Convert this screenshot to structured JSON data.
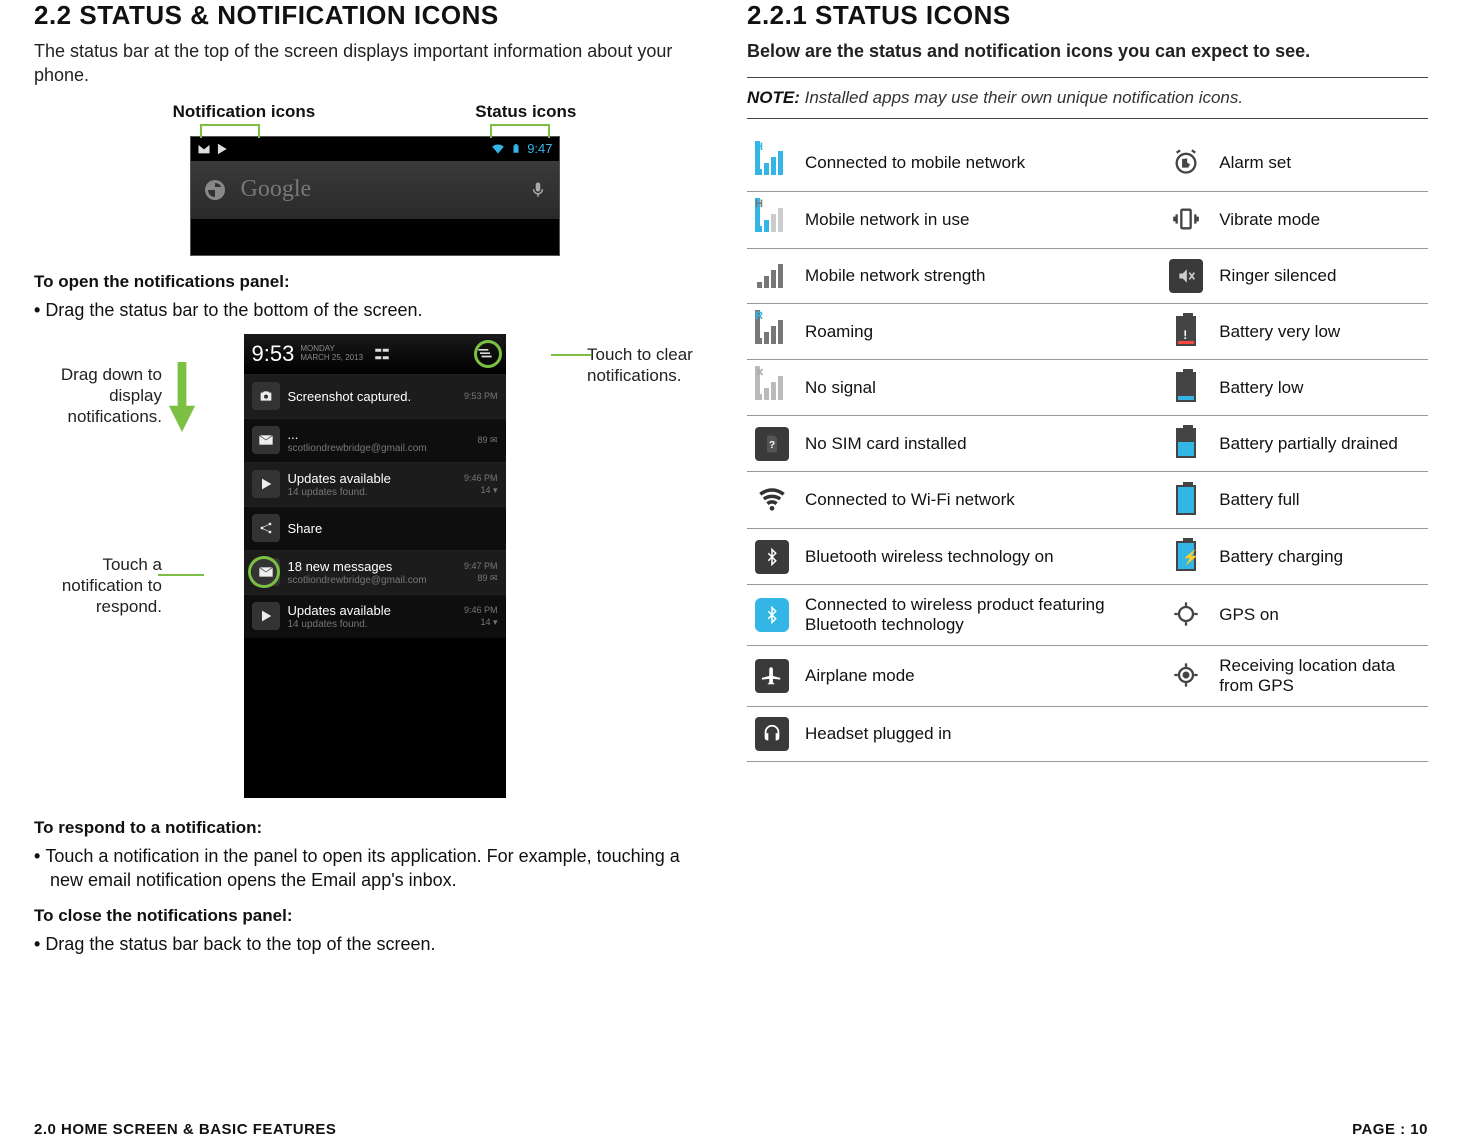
{
  "left": {
    "heading": "2.2 STATUS & NOTIFICATION ICONS",
    "intro": "The status bar at the top of the screen displays important information about your phone.",
    "labels": {
      "notification_icons": "Notification icons",
      "status_icons": "Status icons"
    },
    "statusbar": {
      "time": "9:47",
      "google_placeholder": "Google"
    },
    "open_panel_title": "To open the notifications panel:",
    "open_panel_step": "Drag the status bar to the bottom of the screen.",
    "callouts": {
      "drag_down": "Drag down to display notifications.",
      "touch_respond": "Touch a notification to respond.",
      "touch_clear": "Touch to clear notifications."
    },
    "panel": {
      "time": "9:53",
      "day": "MONDAY",
      "date": "MARCH 25, 2013",
      "rows": [
        {
          "icon": "camera",
          "title": "Screenshot captured.",
          "subtitle": "",
          "meta1": "9:53 PM",
          "meta2": ""
        },
        {
          "icon": "mail",
          "title": "...",
          "subtitle": "scotliondrewbridge@gmail.com",
          "meta1": "",
          "meta2": "89 ✉"
        },
        {
          "icon": "play",
          "title": "Updates available",
          "subtitle": "14 updates found.",
          "meta1": "9:46 PM",
          "meta2": "14 ▾"
        },
        {
          "icon": "share",
          "title": "Share",
          "subtitle": "",
          "meta1": "",
          "meta2": ""
        },
        {
          "icon": "mail",
          "title": "18 new messages",
          "subtitle": "scotliondrewbridge@gmail.com",
          "meta1": "9:47 PM",
          "meta2": "89 ✉"
        },
        {
          "icon": "play",
          "title": "Updates available",
          "subtitle": "14 updates found.",
          "meta1": "9:46 PM",
          "meta2": "14 ▾"
        }
      ]
    },
    "respond_title": "To respond to a notification:",
    "respond_step": "Touch a notification in the panel to open its application. For example, touching a new email notification opens the Email app's inbox.",
    "close_title": "To close the notifications panel:",
    "close_step": "Drag the status bar back to the top of the screen."
  },
  "right": {
    "heading": "2.2.1 STATUS ICONS",
    "intro": "Below are the status and notification icons you can expect to see.",
    "note_label": "NOTE:",
    "note_body": "Installed apps may use their own unique notification icons.",
    "rows": [
      {
        "l_icon": "mobile-h",
        "l_text": "Connected to mobile network",
        "r_icon": "alarm",
        "r_text": "Alarm set"
      },
      {
        "l_icon": "mobile-h-use",
        "l_text": "Mobile network in use",
        "r_icon": "vibrate",
        "r_text": "Vibrate mode"
      },
      {
        "l_icon": "mobile-strength",
        "l_text": "Mobile network strength",
        "r_icon": "silent",
        "r_text": "Ringer silenced"
      },
      {
        "l_icon": "roaming",
        "l_text": "Roaming",
        "r_icon": "batt-vlow",
        "r_text": "Battery very low"
      },
      {
        "l_icon": "no-signal",
        "l_text": "No signal",
        "r_icon": "batt-low",
        "r_text": "Battery low"
      },
      {
        "l_icon": "no-sim",
        "l_text": "No SIM card installed",
        "r_icon": "batt-half",
        "r_text": "Battery partially drained"
      },
      {
        "l_icon": "wifi",
        "l_text": "Connected to Wi-Fi network",
        "r_icon": "batt-full",
        "r_text": "Battery full"
      },
      {
        "l_icon": "bt-on",
        "l_text": "Bluetooth wireless technology on",
        "r_icon": "batt-chg",
        "r_text": "Battery charging"
      },
      {
        "l_icon": "bt-conn",
        "l_text": "Connected to wireless product featuring Bluetooth technology",
        "r_icon": "gps-on",
        "r_text": "GPS on"
      },
      {
        "l_icon": "airplane",
        "l_text": "Airplane mode",
        "r_icon": "gps-rx",
        "r_text": "Receiving location data from GPS"
      },
      {
        "l_icon": "headset",
        "l_text": "Headset plugged in",
        "r_icon": "",
        "r_text": ""
      }
    ]
  },
  "footer": {
    "left": "2.0 HOME SCREEN & BASIC FEATURES",
    "right": "PAGE : 10"
  }
}
